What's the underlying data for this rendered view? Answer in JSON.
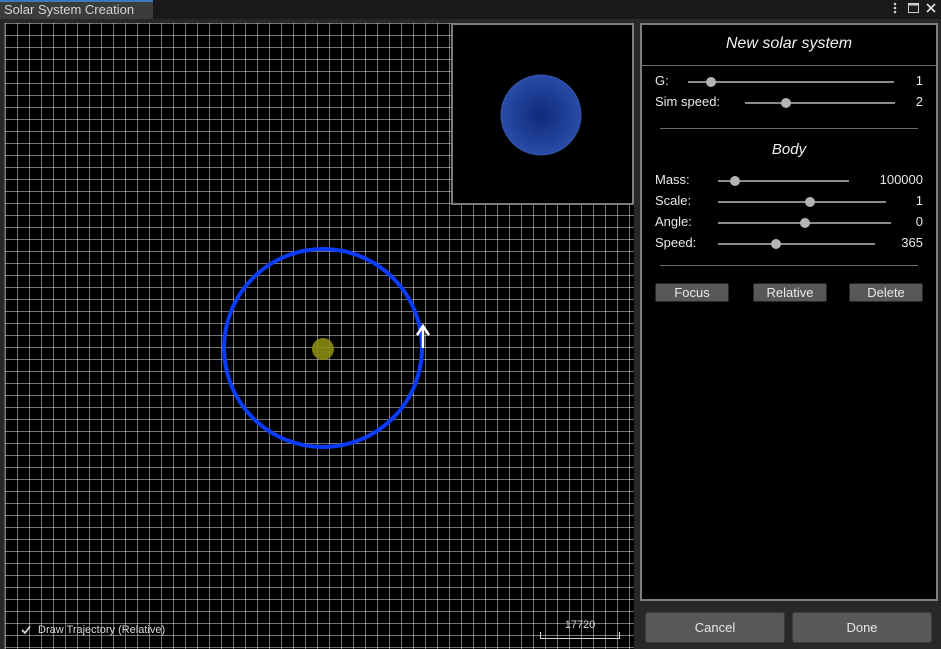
{
  "window": {
    "tab_title": "Solar System Creation",
    "icons": [
      "more-vertical-icon",
      "maximize-icon",
      "close-icon"
    ]
  },
  "viewport": {
    "draw_trajectory_label": "Draw Trajectory (Relative)",
    "draw_trajectory_checked": true,
    "scale_value": "17720",
    "colors": {
      "orbit": "#0a3cff",
      "star": "#8a8a12",
      "planet_preview": "#1c3a8e",
      "grid": "#ffffff"
    }
  },
  "panel": {
    "title": "New solar system",
    "g": {
      "label": "G:",
      "value": "1",
      "fraction": 0.11
    },
    "sim_speed": {
      "label": "Sim speed:",
      "value": "2",
      "fraction": 0.27
    },
    "body_title": "Body",
    "mass": {
      "label": "Mass:",
      "value": "100000",
      "fraction": 0.13
    },
    "scale": {
      "label": "Scale:",
      "value": "1",
      "fraction": 0.55
    },
    "angle": {
      "label": "Angle:",
      "value": "0",
      "fraction": 0.5
    },
    "speed": {
      "label": "Speed:",
      "value": "365",
      "fraction": 0.37
    },
    "buttons": {
      "focus": "Focus",
      "relative": "Relative",
      "delete": "Delete"
    }
  },
  "footer": {
    "cancel": "Cancel",
    "done": "Done"
  }
}
